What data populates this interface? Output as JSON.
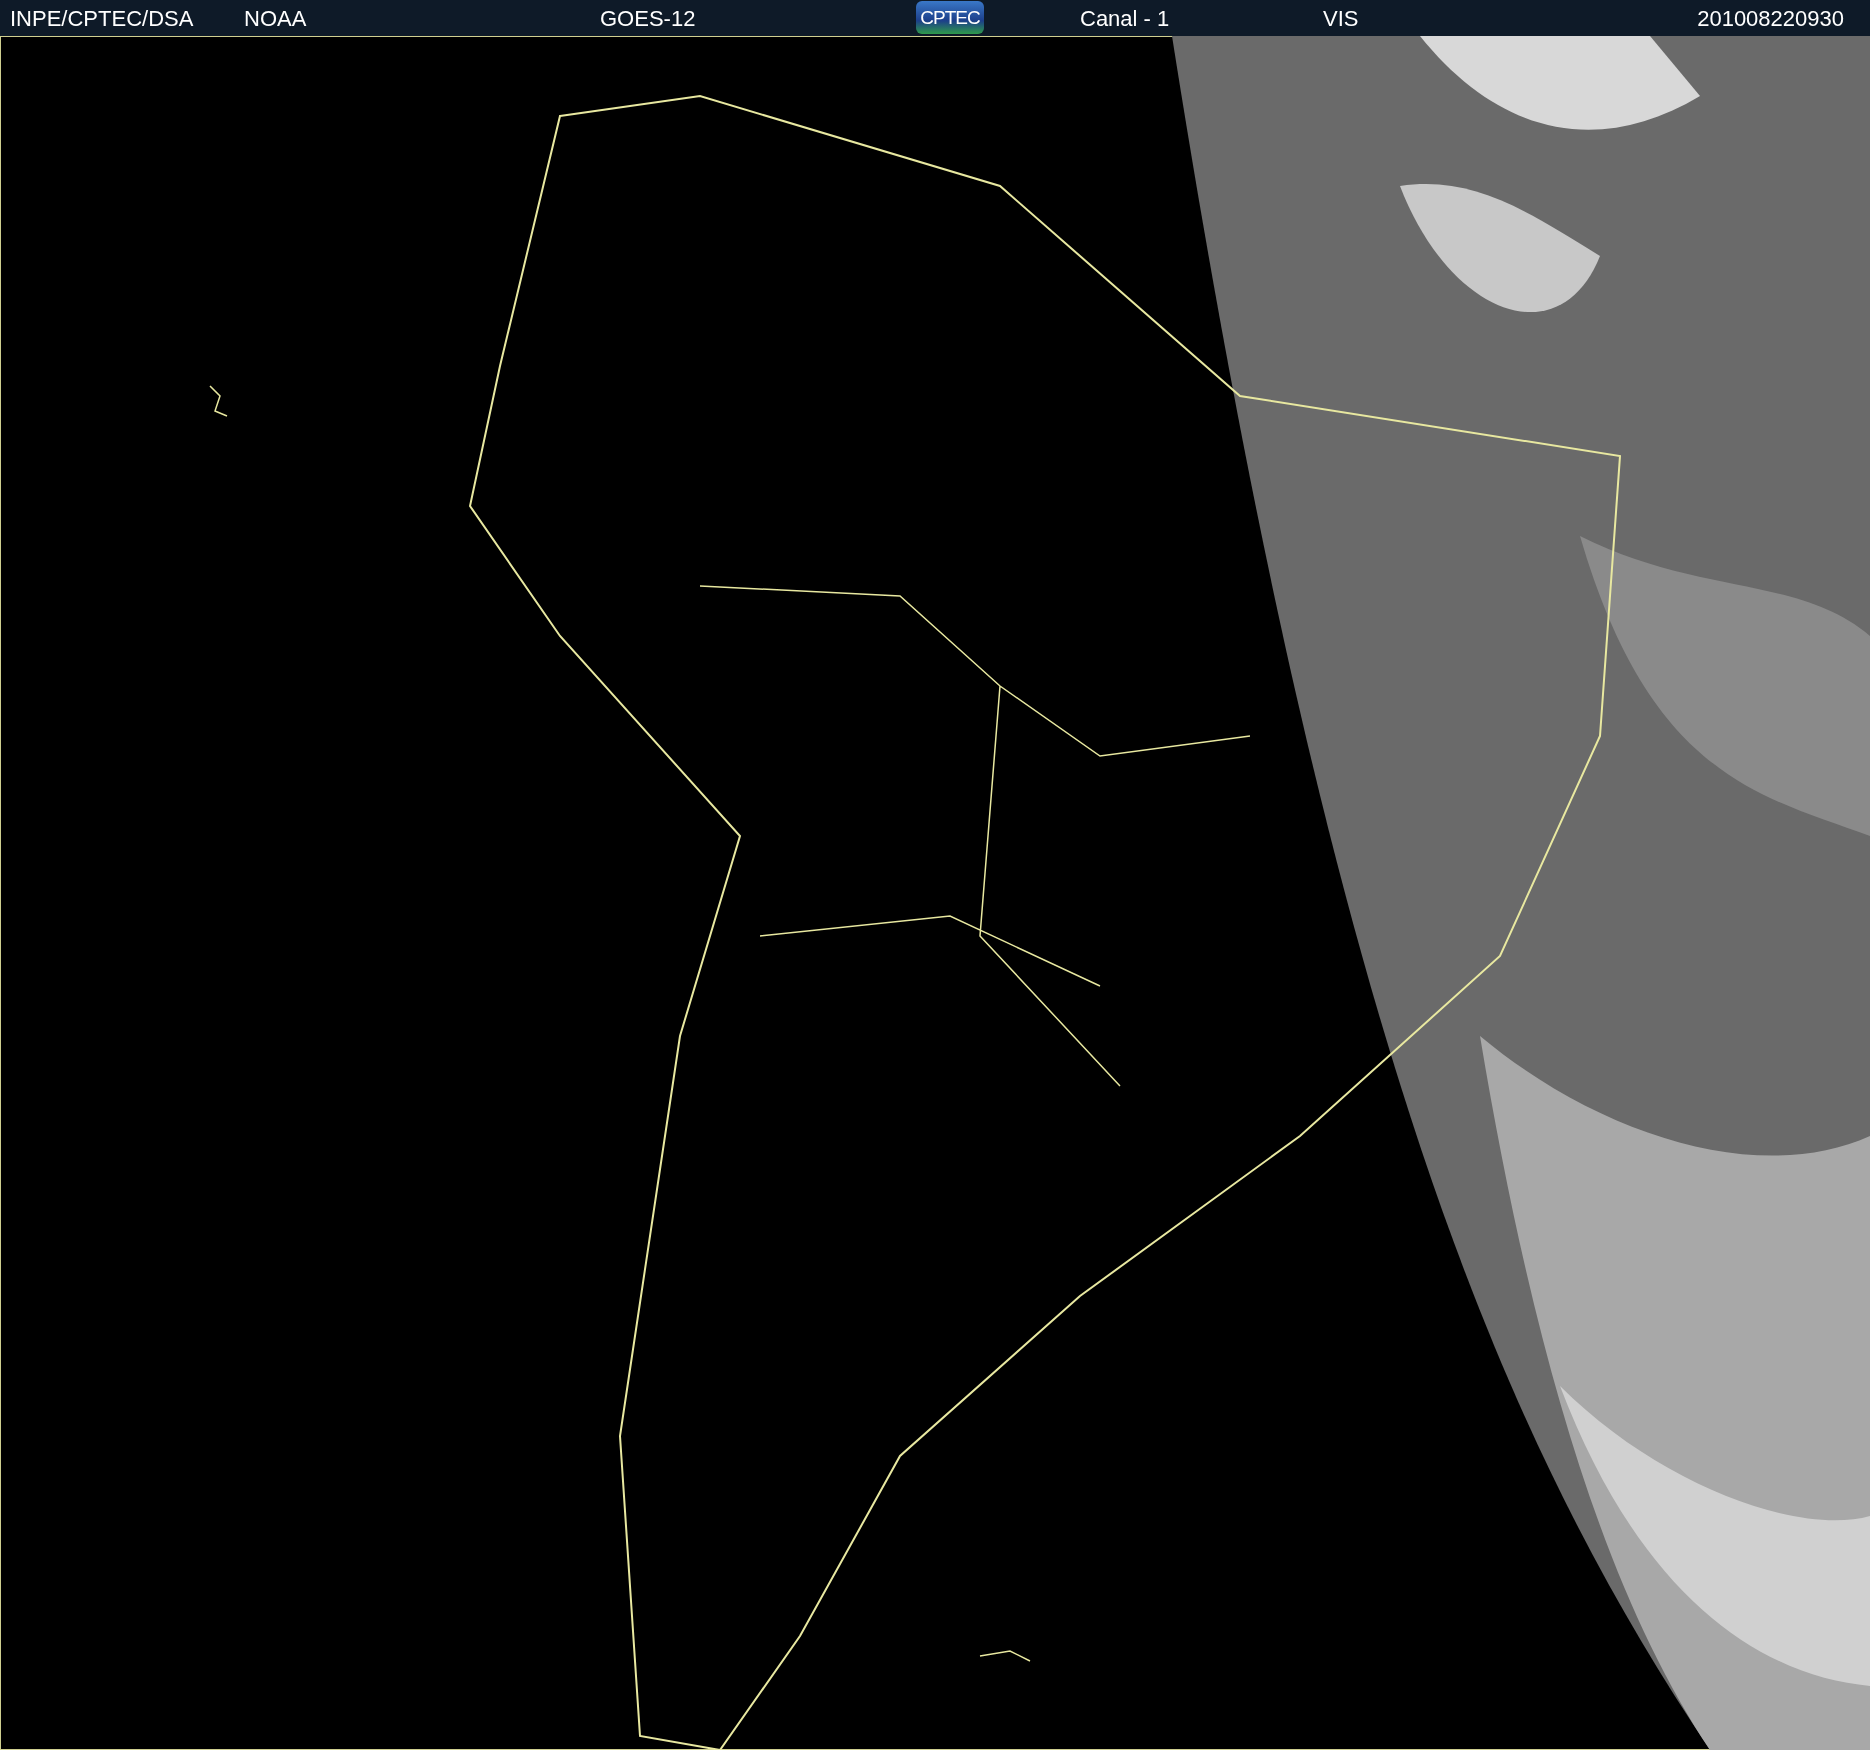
{
  "header": {
    "source": "INPE/CPTEC/DSA",
    "agency": "NOAA",
    "satellite": "GOES-12",
    "logo": "CPTEC",
    "channel": "Canal - 1",
    "band": "VIS",
    "timestamp": "201008220930"
  }
}
